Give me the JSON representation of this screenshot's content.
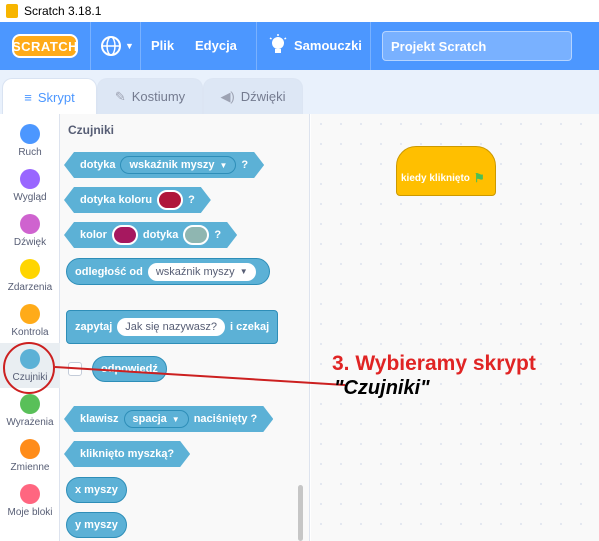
{
  "window": {
    "title": "Scratch 3.18.1"
  },
  "menubar": {
    "logo": "SCRATCH",
    "file": "Plik",
    "edit": "Edycja",
    "tutorials": "Samouczki",
    "project_title": "Projekt Scratch"
  },
  "tabs": [
    {
      "label": "Skrypt",
      "icon": "code-icon"
    },
    {
      "label": "Kostiumy",
      "icon": "paintbrush-icon"
    },
    {
      "label": "Dźwięki",
      "icon": "speaker-icon"
    }
  ],
  "categories": [
    {
      "label": "Ruch",
      "color": "#4c97ff"
    },
    {
      "label": "Wygląd",
      "color": "#9966ff"
    },
    {
      "label": "Dźwięk",
      "color": "#cf63cf"
    },
    {
      "label": "Zdarzenia",
      "color": "#ffd500"
    },
    {
      "label": "Kontrola",
      "color": "#ffab19"
    },
    {
      "label": "Czujniki",
      "color": "#5cb1d6"
    },
    {
      "label": "Wyrażenia",
      "color": "#59c059"
    },
    {
      "label": "Zmienne",
      "color": "#ff8c1a"
    },
    {
      "label": "Moje bloki",
      "color": "#ff6680"
    }
  ],
  "palette": {
    "title": "Czujniki",
    "blocks": {
      "touching": {
        "text": "dotyka",
        "dropdown": "wskaźnik myszy",
        "end": "?"
      },
      "touching_color": {
        "text": "dotyka koloru",
        "end": "?",
        "swatch": "#b0173a"
      },
      "color_touching": {
        "text1": "kolor",
        "text2": "dotyka",
        "end": "?",
        "swatch1": "#a6185f",
        "swatch2": "#8fb6b1"
      },
      "distance": {
        "text": "odległość od",
        "dropdown": "wskaźnik myszy"
      },
      "ask": {
        "text1": "zapytaj",
        "field": "Jak się nazywasz?",
        "text2": "i czekaj"
      },
      "answer": {
        "text": "odpowiedź"
      },
      "key_pressed": {
        "text1": "klawisz",
        "dropdown": "spacja",
        "text2": "naciśnięty ?"
      },
      "mouse_down": {
        "text": "kliknięto myszką?"
      },
      "mouse_x": {
        "text": "x myszy"
      },
      "mouse_y": {
        "text": "y myszy"
      }
    }
  },
  "workspace": {
    "hat_block": "kiedy kliknięto"
  },
  "annotation": {
    "line1": "3. Wybieramy skrypt",
    "line2": "\"Czujniki\""
  },
  "colors": {
    "menubar": "#4c97ff",
    "sensing": "#5cb1d6",
    "event": "#ffbf00",
    "annotation": "#e02424"
  }
}
